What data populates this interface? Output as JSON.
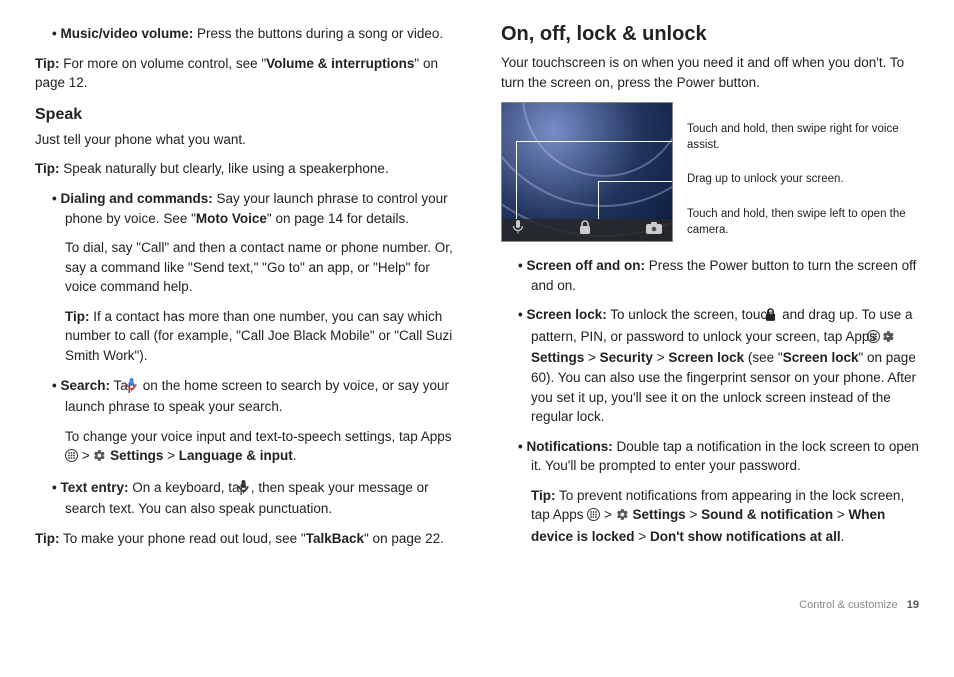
{
  "left": {
    "bullet_mv": {
      "lead": "Music/video volume:",
      "rest": " Press the buttons during a song or video."
    },
    "tip_volume": {
      "prefix": "Tip:",
      "mid": " For more on volume control, see \"",
      "link": "Volume & interruptions",
      "suffix": "\" on page 12."
    },
    "speak_heading": "Speak",
    "speak_intro": "Just tell your phone what you want.",
    "tip_speak": {
      "prefix": "Tip:",
      "rest": " Speak naturally but clearly, like using a speakerphone."
    },
    "dialing": {
      "lead": "Dialing and commands:",
      "rest": " Say your launch phrase to control your phone by voice. See \"",
      "link": "Moto Voice",
      "suffix": "\" on page 14 for details."
    },
    "dialing_p2": "To dial, say \"Call\" and then a contact name or phone number. Or, say a command like \"Send text,\" \"Go to\" an app, or \"Help\" for voice command help.",
    "dialing_tip": {
      "prefix": "Tip:",
      "rest": " If a contact has more than one number, you can say which number to call (for example, \"Call Joe Black Mobile\" or \"Call Suzi Smith Work\")."
    },
    "search": {
      "lead": "Search:",
      "pre": " Tap ",
      "post": " on the home screen to search by voice, or say your launch phrase to speak your search."
    },
    "search_p2_pre": "To change your voice input and text-to-speech settings, tap Apps ",
    "search_p2_settings": " Settings",
    "search_p2_lang": "Language & input",
    "text_entry": {
      "lead": "Text entry:",
      "pre": " On a keyboard, tap ",
      "post": ", then speak your message or search text. You can also speak punctuation."
    },
    "talkback": {
      "prefix": "Tip:",
      "mid": " To make your phone read out loud, see \"",
      "link": "TalkBack",
      "suffix": "\" on page 22."
    }
  },
  "right": {
    "heading": "On, off, lock & unlock",
    "intro": "Your touchscreen is on when you need it and off when you don't. To turn the screen on, press the Power button.",
    "hint1": "Touch and hold, then swipe right for voice assist.",
    "hint2": "Drag up to unlock your screen.",
    "hint3": "Touch and hold, then swipe left to open the camera.",
    "screen_off": {
      "lead": "Screen off and on:",
      "rest": " Press the Power button to turn the screen off and on."
    },
    "screen_lock": {
      "lead": "Screen lock:",
      "pre": " To unlock the screen, touch ",
      "mid1": " and drag up. To use a pattern, PIN, or password to unlock your screen, tap Apps ",
      "settings": " Settings",
      "sec": "Security",
      "sl": "Screen lock",
      "mid2": " (see \"",
      "link": "Screen lock",
      "mid3": "\" on page 60). You can also use the fingerprint sensor on your phone. After you set it up, you'll see it on the unlock screen instead of the regular lock."
    },
    "notif": {
      "lead": "Notifications:",
      "rest": " Double tap a notification in the lock screen to open it. You'll be prompted to enter your password."
    },
    "notif_tip": {
      "prefix": "Tip:",
      "pre": " To prevent notifications from appearing in the lock screen, tap Apps ",
      "settings": " Settings",
      "sn": "Sound & notification",
      "wdl": "When device is locked",
      "dsa": "Don't show notifications at all"
    }
  },
  "footer": {
    "section": "Control & customize",
    "page": "19"
  }
}
